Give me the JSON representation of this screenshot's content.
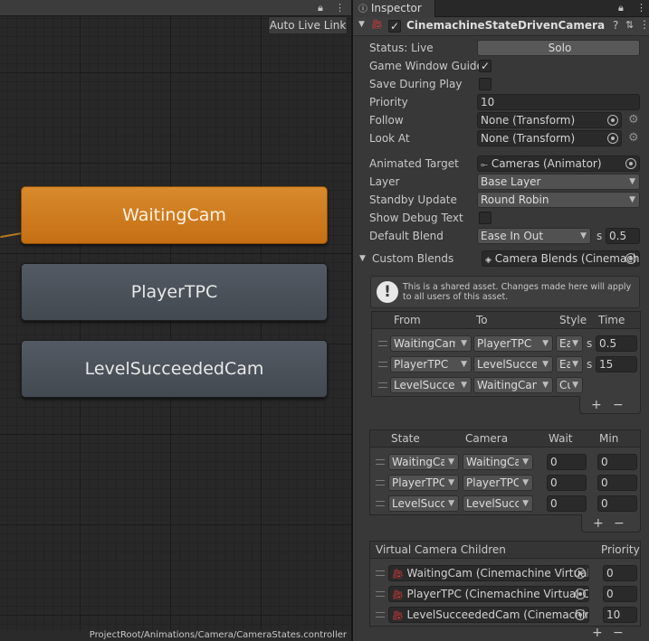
{
  "graph": {
    "auto_live_link": "Auto Live Link",
    "states": [
      "WaitingCam",
      "PlayerTPC",
      "LevelSucceededCam"
    ],
    "active_state": "WaitingCam",
    "path": "ProjectRoot/Animations/Camera/CameraStates.controller"
  },
  "inspector": {
    "tab_label": "Inspector",
    "component_title": "CinemachineStateDrivenCamera",
    "status_label": "Status: Live",
    "solo_label": "Solo",
    "fields": {
      "game_window_guides": "Game Window Guides",
      "save_during_play": "Save During Play",
      "priority_label": "Priority",
      "priority_value": "10",
      "follow_label": "Follow",
      "follow_value": "None (Transform)",
      "look_at_label": "Look At",
      "look_at_value": "None (Transform)",
      "animated_target_label": "Animated Target",
      "animated_target_value": "Cameras (Animator)",
      "layer_label": "Layer",
      "layer_value": "Base Layer",
      "standby_label": "Standby Update",
      "standby_value": "Round Robin",
      "debug_label": "Show Debug Text",
      "default_blend_label": "Default Blend",
      "default_blend_value": "Ease In Out",
      "default_blend_unit": "s",
      "default_blend_time": "0.5",
      "custom_blends_label": "Custom Blends",
      "custom_blends_value": "Camera Blends (Cinemachine"
    },
    "shared_notice": "This is a shared asset.  Changes made here will apply to all users of this asset.",
    "blends_table": {
      "headers": [
        "From",
        "To",
        "Style",
        "Time"
      ],
      "rows": [
        {
          "from": "WaitingCam",
          "to": "PlayerTPC",
          "style": "Ease",
          "unit": "s",
          "time": "0.5"
        },
        {
          "from": "PlayerTPC",
          "to": "LevelSucceededCam",
          "style": "Ease",
          "unit": "s",
          "time": "15"
        },
        {
          "from": "LevelSucceededCam",
          "to": "WaitingCam",
          "style": "Cut",
          "unit": "",
          "time": ""
        }
      ]
    },
    "states_table": {
      "headers": [
        "State",
        "Camera",
        "Wait",
        "Min"
      ],
      "rows": [
        {
          "state": "WaitingCam",
          "camera": "WaitingCam",
          "wait": "0",
          "min": "0"
        },
        {
          "state": "PlayerTPC",
          "camera": "PlayerTPC",
          "wait": "0",
          "min": "0"
        },
        {
          "state": "LevelSucceededCam",
          "camera": "LevelSucceededCam",
          "wait": "0",
          "min": "0"
        }
      ]
    },
    "children_table": {
      "headers": [
        "Virtual Camera Children",
        "Priority"
      ],
      "rows": [
        {
          "name": "WaitingCam (Cinemachine Virtual Camera)",
          "priority": "0"
        },
        {
          "name": "PlayerTPC (Cinemachine Virtual Camera)",
          "priority": "0"
        },
        {
          "name": "LevelSucceededCam (Cinemachine Virtual Camera)",
          "priority": "10"
        }
      ]
    },
    "plus": "+",
    "minus": "−"
  },
  "icons": [
    "lock-icon",
    "kebab-menu-icon",
    "foldout-arrow-icon",
    "camera-icon",
    "help-icon",
    "settings-icon",
    "target-picker-icon",
    "gear-icon",
    "info-icon",
    "drag-handle-icon",
    "animator-icon",
    "asset-icon"
  ]
}
